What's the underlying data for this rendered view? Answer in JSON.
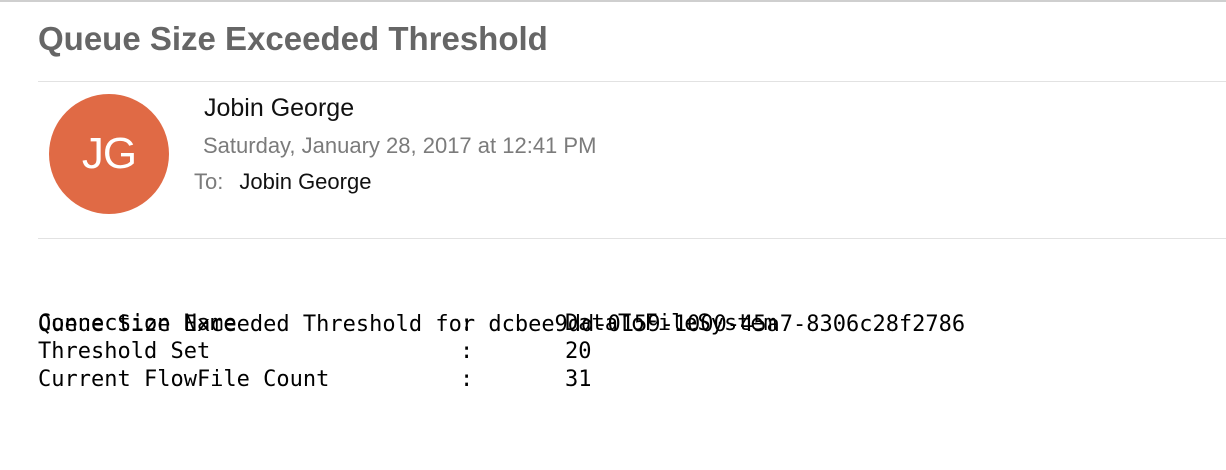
{
  "email": {
    "subject": "Queue Size Exceeded Threshold",
    "sender": {
      "initials": "JG",
      "name": "Jobin George",
      "avatar_color": "#e06a45"
    },
    "date": "Saturday, January 28, 2017 at 12:41 PM",
    "to_label": "To:",
    "to": "Jobin George",
    "body": {
      "heading": "Queue Size Exceeded Threshold for dcbee9dd-0159-1000-45a7-8306c28f2786",
      "fields": [
        {
          "name": "Connection Name",
          "separator": ":",
          "value": "DataToFileSystem"
        },
        {
          "name": "Threshold Set",
          "separator": ":",
          "value": "20"
        },
        {
          "name": "Current FlowFile Count",
          "separator": ":",
          "value": "31"
        }
      ]
    }
  }
}
